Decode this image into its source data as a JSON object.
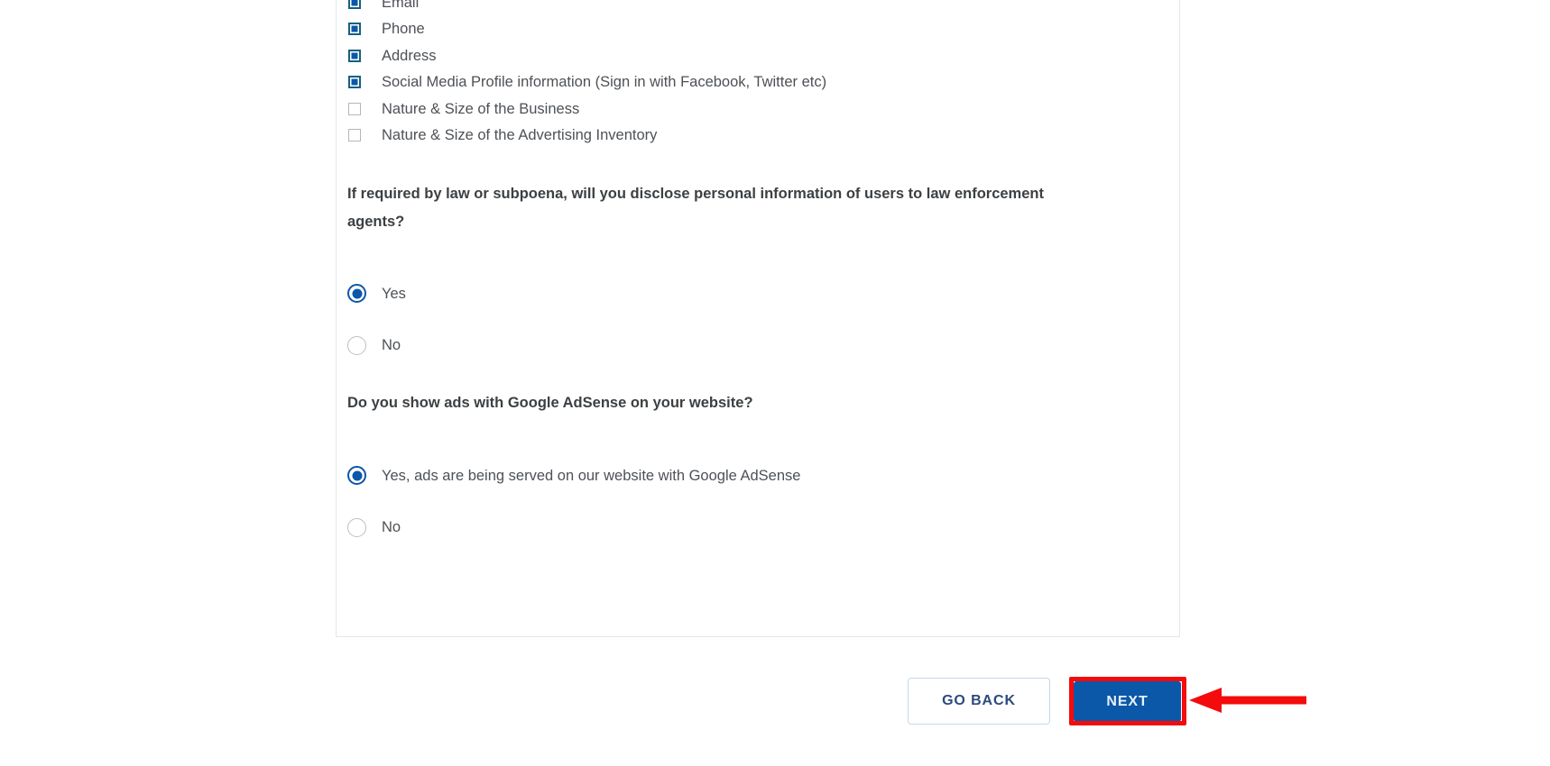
{
  "form": {
    "data_collection": {
      "items": [
        {
          "label": "Email",
          "checked": true,
          "clipped_top": true
        },
        {
          "label": "Phone",
          "checked": true
        },
        {
          "label": "Address",
          "checked": true
        },
        {
          "label": "Social Media Profile information (Sign in with Facebook, Twitter etc)",
          "checked": true
        },
        {
          "label": "Nature & Size of the Business",
          "checked": false
        },
        {
          "label": "Nature & Size of the Advertising Inventory",
          "checked": false
        }
      ]
    },
    "question_law": {
      "text": "If required by law or subpoena, will you disclose personal information of users to law enforcement agents?",
      "options": [
        {
          "label": "Yes",
          "selected": true
        },
        {
          "label": "No",
          "selected": false
        }
      ]
    },
    "question_adsense": {
      "text": "Do you show ads with Google AdSense on your website?",
      "options": [
        {
          "label": "Yes, ads are being served on our website with Google AdSense",
          "selected": true
        },
        {
          "label": "No",
          "selected": false
        }
      ]
    }
  },
  "footer": {
    "go_back_label": "GO BACK",
    "next_label": "NEXT"
  },
  "annotation": {
    "highlight_target": "NEXT",
    "color": "#f40b0b",
    "arrow_direction": "left"
  },
  "colors": {
    "primary_blue": "#0b57a8",
    "checkbox_border": "#15607f",
    "unchecked_border": "#b4b7ba",
    "text": "#4d5156",
    "heading": "#3c4043",
    "go_back_text": "#2c4a7d",
    "go_back_border": "#c7d7ea",
    "card_border": "#e4e6e8",
    "annotation_red": "#f40b0b"
  }
}
